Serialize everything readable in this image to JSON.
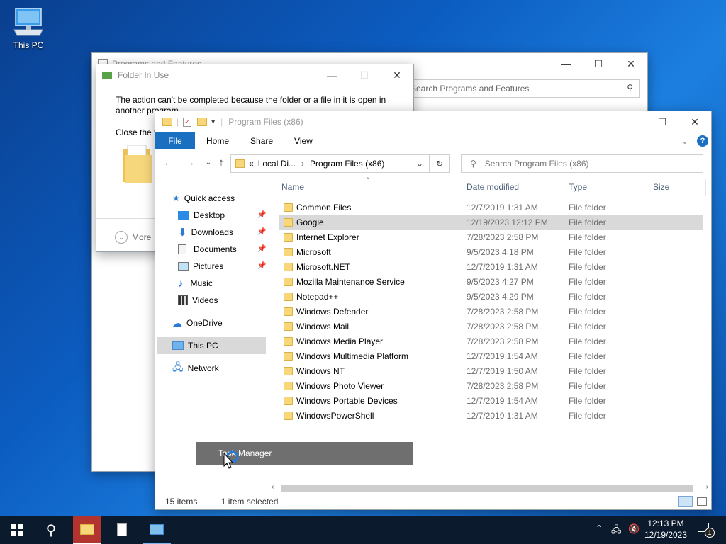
{
  "desktop": {
    "icon_label": "This PC"
  },
  "programs_features": {
    "title": "Programs and Features",
    "search_placeholder": "Search Programs and Features"
  },
  "folder_in_use": {
    "title": "Folder In Use",
    "message": "The action can't be completed because the folder or a file in it is open in another program",
    "message2": "Close the f",
    "more_label": "More"
  },
  "explorer": {
    "title": "Program Files (x86)",
    "ribbon_tabs": [
      "File",
      "Home",
      "Share",
      "View"
    ],
    "breadcrumb": [
      "Local Di...",
      "Program Files (x86)"
    ],
    "search_placeholder": "Search Program Files (x86)",
    "columns": {
      "name": "Name",
      "date": "Date modified",
      "type": "Type",
      "size": "Size"
    },
    "nav": {
      "quick_access": "Quick access",
      "desktop": "Desktop",
      "downloads": "Downloads",
      "documents": "Documents",
      "pictures": "Pictures",
      "music": "Music",
      "videos": "Videos",
      "onedrive": "OneDrive",
      "this_pc": "This PC",
      "network": "Network"
    },
    "rows": [
      {
        "name": "Common Files",
        "date": "12/7/2019 1:31 AM",
        "type": "File folder"
      },
      {
        "name": "Google",
        "date": "12/19/2023 12:12 PM",
        "type": "File folder"
      },
      {
        "name": "Internet Explorer",
        "date": "7/28/2023 2:58 PM",
        "type": "File folder"
      },
      {
        "name": "Microsoft",
        "date": "9/5/2023 4:18 PM",
        "type": "File folder"
      },
      {
        "name": "Microsoft.NET",
        "date": "12/7/2019 1:31 AM",
        "type": "File folder"
      },
      {
        "name": "Mozilla Maintenance Service",
        "date": "9/5/2023 4:27 PM",
        "type": "File folder"
      },
      {
        "name": "Notepad++",
        "date": "9/5/2023 4:29 PM",
        "type": "File folder"
      },
      {
        "name": "Windows Defender",
        "date": "7/28/2023 2:58 PM",
        "type": "File folder"
      },
      {
        "name": "Windows Mail",
        "date": "7/28/2023 2:58 PM",
        "type": "File folder"
      },
      {
        "name": "Windows Media Player",
        "date": "7/28/2023 2:58 PM",
        "type": "File folder"
      },
      {
        "name": "Windows Multimedia Platform",
        "date": "12/7/2019 1:54 AM",
        "type": "File folder"
      },
      {
        "name": "Windows NT",
        "date": "12/7/2019 1:50 AM",
        "type": "File folder"
      },
      {
        "name": "Windows Photo Viewer",
        "date": "7/28/2023 2:58 PM",
        "type": "File folder"
      },
      {
        "name": "Windows Portable Devices",
        "date": "12/7/2019 1:54 AM",
        "type": "File folder"
      },
      {
        "name": "WindowsPowerShell",
        "date": "12/7/2019 1:31 AM",
        "type": "File folder"
      }
    ],
    "item_count": "15 items",
    "selection": "1 item selected"
  },
  "tooltip": {
    "label": "Task Manager"
  },
  "taskbar": {
    "time": "12:13 PM",
    "date": "12/19/2023",
    "notification_count": "1"
  },
  "colors": {
    "accent": "#1a6fc0",
    "taskbar": "#0c1a2e",
    "active_app": "#b3332e",
    "selected_row": "#d9d9d9"
  }
}
